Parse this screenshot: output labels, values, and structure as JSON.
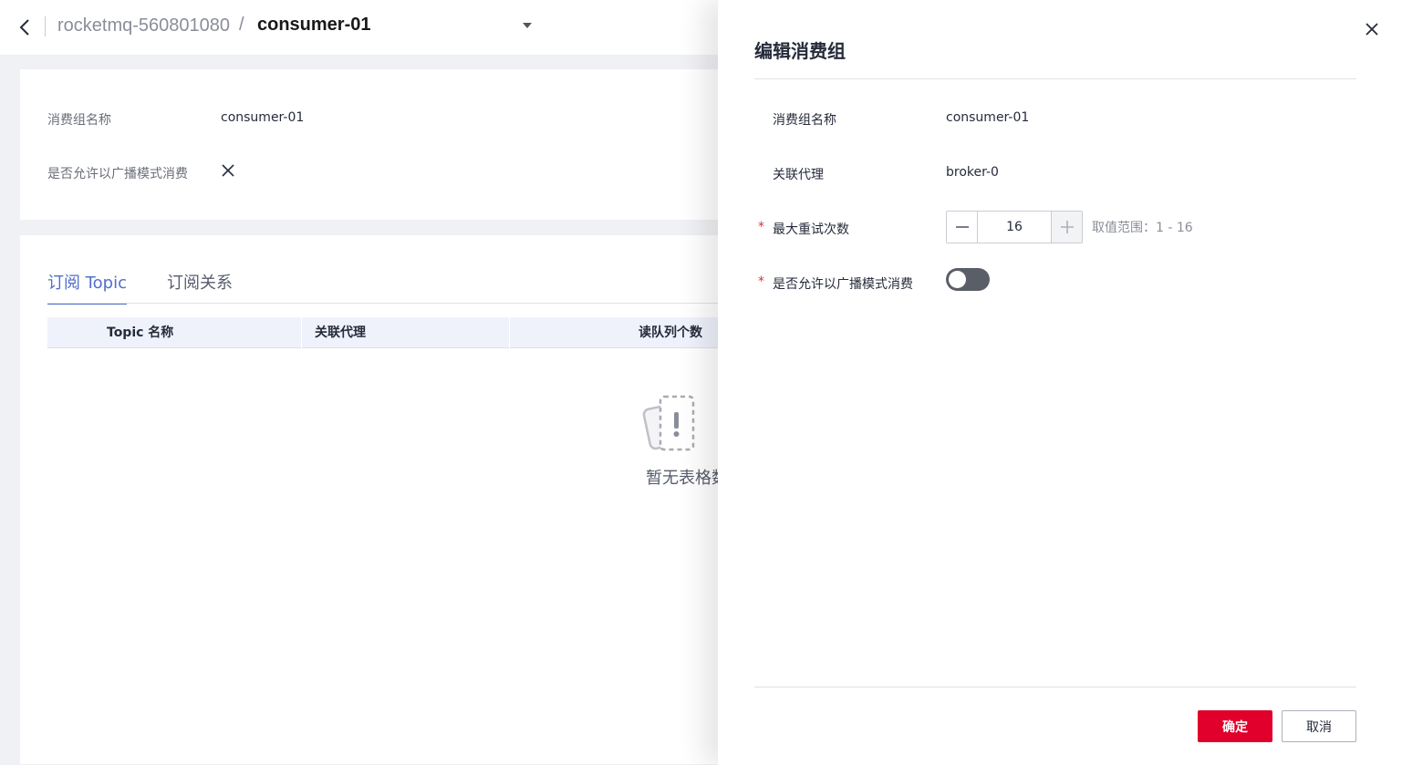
{
  "header": {
    "back_icon": "chevron-left-icon",
    "breadcrumb_parent": "rocketmq-560801080",
    "breadcrumb_separator": "/",
    "breadcrumb_current": "consumer-01",
    "dropdown_icon": "caret-down-icon"
  },
  "info": {
    "group_name_label": "消费组名称",
    "group_name_value": "consumer-01",
    "broadcast_label": "是否允许以广播模式消费",
    "broadcast_icon": "cross-icon"
  },
  "tabs": [
    {
      "label": "订阅 Topic",
      "active": true
    },
    {
      "label": "订阅关系",
      "active": false
    }
  ],
  "table": {
    "columns": [
      "Topic 名称",
      "关联代理",
      "读队列个数"
    ],
    "empty_icon": "empty-table-icon",
    "empty_text": "暂无表格数"
  },
  "drawer": {
    "title": "编辑消费组",
    "close_icon": "close-icon",
    "fields": {
      "group_name_label": "消费组名称",
      "group_name_value": "consumer-01",
      "broker_label": "关联代理",
      "broker_value": "broker-0",
      "required_mark": "*",
      "retry_label": "最大重试次数",
      "retry_value": "16",
      "retry_range": "取值范围：1 - 16",
      "broadcast_label": "是否允许以广播模式消费",
      "broadcast_enabled": false
    },
    "confirm_label": "确定",
    "cancel_label": "取消"
  },
  "colors": {
    "accent": "#526ecc",
    "primary_button": "#e0002b",
    "required": "#e0303a",
    "toggle_off": "#5a5e66"
  }
}
